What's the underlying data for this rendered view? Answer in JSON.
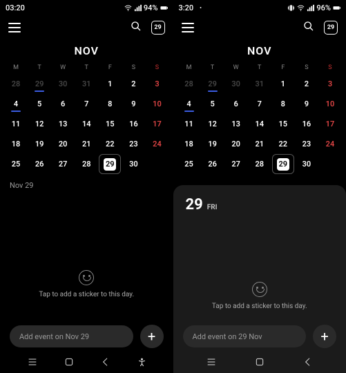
{
  "left": {
    "status": {
      "time": "03:20",
      "battery": "94%"
    },
    "today_badge": "29",
    "month": "NOV",
    "weekdays": [
      "M",
      "T",
      "W",
      "T",
      "F",
      "S",
      "S"
    ],
    "weeks": [
      [
        {
          "d": "28",
          "p": 1
        },
        {
          "d": "29",
          "p": 1,
          "bar": 1
        },
        {
          "d": "30",
          "p": 1
        },
        {
          "d": "31",
          "p": 1
        },
        {
          "d": "1"
        },
        {
          "d": "2"
        },
        {
          "d": "3",
          "s": 1
        }
      ],
      [
        {
          "d": "4",
          "bar": 1
        },
        {
          "d": "5"
        },
        {
          "d": "6"
        },
        {
          "d": "7"
        },
        {
          "d": "8"
        },
        {
          "d": "9"
        },
        {
          "d": "10",
          "s": 1
        }
      ],
      [
        {
          "d": "11"
        },
        {
          "d": "12"
        },
        {
          "d": "13"
        },
        {
          "d": "14"
        },
        {
          "d": "15"
        },
        {
          "d": "16"
        },
        {
          "d": "17",
          "s": 1
        }
      ],
      [
        {
          "d": "18"
        },
        {
          "d": "19"
        },
        {
          "d": "20"
        },
        {
          "d": "21"
        },
        {
          "d": "22"
        },
        {
          "d": "23"
        },
        {
          "d": "24",
          "s": 1
        }
      ],
      [
        {
          "d": "25"
        },
        {
          "d": "26"
        },
        {
          "d": "27"
        },
        {
          "d": "28"
        },
        {
          "d": "29",
          "today": 1,
          "box": 1
        },
        {
          "d": "30"
        },
        {
          "d": ""
        }
      ]
    ],
    "panel": {
      "header": "Nov 29",
      "sticker_text": "Tap to add a sticker to this day.",
      "add_event": "Add event on Nov 29"
    }
  },
  "right": {
    "status": {
      "time": "3:20",
      "battery": "96%"
    },
    "today_badge": "29",
    "month": "NOV",
    "weekdays": [
      "M",
      "T",
      "W",
      "T",
      "F",
      "S",
      "S"
    ],
    "weeks": [
      [
        {
          "d": "28",
          "p": 1
        },
        {
          "d": "29",
          "p": 1,
          "bar": 1
        },
        {
          "d": "30",
          "p": 1
        },
        {
          "d": "31",
          "p": 1
        },
        {
          "d": "1"
        },
        {
          "d": "2"
        },
        {
          "d": "3",
          "s": 1
        }
      ],
      [
        {
          "d": "4",
          "bar": 1
        },
        {
          "d": "5"
        },
        {
          "d": "6"
        },
        {
          "d": "7"
        },
        {
          "d": "8"
        },
        {
          "d": "9"
        },
        {
          "d": "10",
          "s": 1
        }
      ],
      [
        {
          "d": "11"
        },
        {
          "d": "12"
        },
        {
          "d": "13"
        },
        {
          "d": "14"
        },
        {
          "d": "15"
        },
        {
          "d": "16"
        },
        {
          "d": "17",
          "s": 1
        }
      ],
      [
        {
          "d": "18"
        },
        {
          "d": "19"
        },
        {
          "d": "20"
        },
        {
          "d": "21"
        },
        {
          "d": "22"
        },
        {
          "d": "23"
        },
        {
          "d": "24",
          "s": 1
        }
      ],
      [
        {
          "d": "25"
        },
        {
          "d": "26"
        },
        {
          "d": "27"
        },
        {
          "d": "28"
        },
        {
          "d": "29",
          "today": 1,
          "box": 1
        },
        {
          "d": "30"
        },
        {
          "d": ""
        }
      ]
    ],
    "panel": {
      "big": "29",
      "dow": "FRI",
      "sticker_text": "Tap to add a sticker to this day.",
      "add_event": "Add event on 29 Nov"
    }
  }
}
